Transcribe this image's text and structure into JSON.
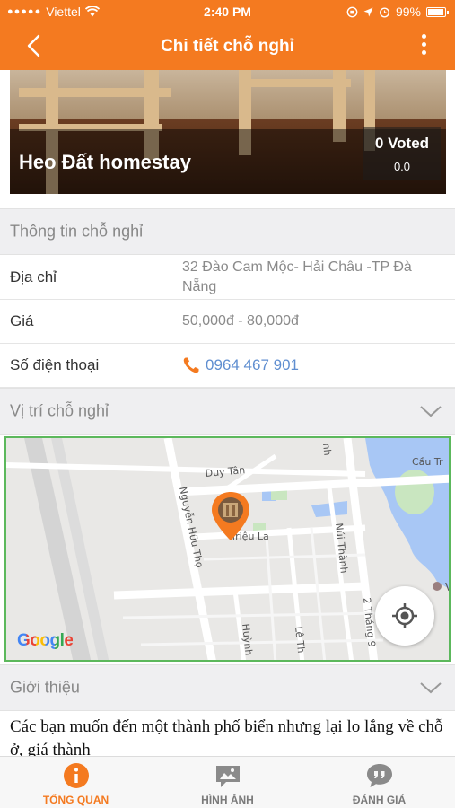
{
  "status_bar": {
    "carrier": "Viettel",
    "time": "2:40 PM",
    "battery": "99%",
    "battery_level": 0.99
  },
  "nav": {
    "title": "Chi tiết chỗ nghỉ"
  },
  "hero": {
    "name": "Heo Đất homestay",
    "voted": "0 Voted",
    "score": "0.0"
  },
  "info_section": {
    "header": "Thông tin chỗ nghỉ",
    "rows": [
      {
        "key": "Địa chỉ",
        "value": "32 Đào Cam Mộc- Hải Châu -TP Đà Nẵng"
      },
      {
        "key": "Giá",
        "value": "50,000đ - 80,000đ"
      },
      {
        "key": "Số điện thoại",
        "value": "0964 467 901"
      }
    ]
  },
  "location_section": {
    "header": "Vị trí chỗ nghỉ"
  },
  "map": {
    "streets": [
      "Duy Tân",
      "Nguyễn Hữu Thọ",
      "Triệu La",
      "Núi Thành",
      "2 Tháng 9",
      "Cầu Tr",
      "Huỳnh",
      "Lê Th",
      "nh"
    ],
    "attribution": "Google",
    "water_color": "#a8c7f5",
    "park_color": "#c9e6c0",
    "pin_color": "#f47a20"
  },
  "intro_section": {
    "header": "Giới thiệu",
    "text": "Các bạn muốn đến một thành phố biển nhưng lại lo lắng về chỗ ở, giá thành"
  },
  "tabs": [
    {
      "label": "TỔNG QUAN",
      "icon": "info-icon",
      "active": true
    },
    {
      "label": "HÌNH ẢNH",
      "icon": "image-icon",
      "active": false
    },
    {
      "label": "ĐÁNH GIÁ",
      "icon": "chat-quote-icon",
      "active": false
    }
  ],
  "colors": {
    "accent": "#f47a20",
    "link": "#5f8ed0",
    "section_bg": "#efeff1",
    "map_border": "#5cb85c"
  }
}
